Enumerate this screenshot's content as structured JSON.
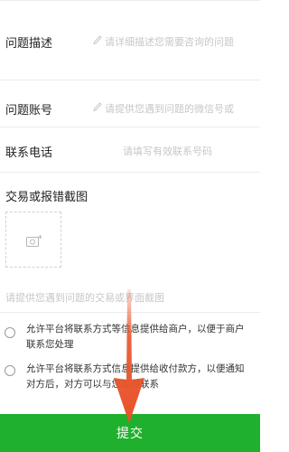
{
  "form": {
    "description": {
      "label": "问题描述",
      "placeholder": "请详细描述您需要咨询的问题"
    },
    "account": {
      "label": "问题账号",
      "placeholder": "请提供您遇到问题的微信号或"
    },
    "phone": {
      "label": "联系电话",
      "placeholder": "请填写有效联系号码"
    },
    "screenshot": {
      "label": "交易或报错截图",
      "hint": "请提供您遇到问题的交易或界面截图"
    }
  },
  "agreements": [
    {
      "text": "允许平台将联系方式等信息提供给商户，以便于商户联系您处理"
    },
    {
      "text": "允许平台将联系方式信息提供给收付款方，以便通知对方后，对方可以与您取得联系"
    }
  ],
  "submit_label": "提交",
  "colors": {
    "accent": "#1fb12e",
    "annotation_arrow": "#e8532a"
  },
  "icons": {
    "edit": "pencil-icon",
    "upload": "camera-icon",
    "annotation": "arrow-down-icon"
  }
}
